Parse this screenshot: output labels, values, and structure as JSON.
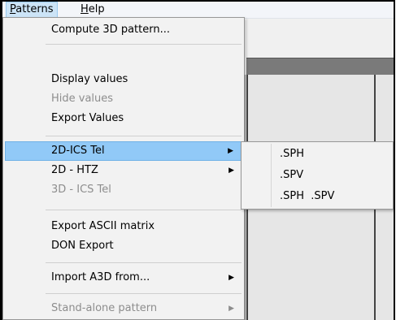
{
  "menubar": {
    "patterns_label": "Patterns",
    "patterns_underline": "P",
    "patterns_rest": "atterns",
    "help_underline": "H",
    "help_rest": "elp"
  },
  "menu": {
    "items": [
      {
        "label": "Compute 3D pattern...",
        "enabled": true
      },
      {
        "label": "Display values",
        "enabled": true
      },
      {
        "label": "Hide values",
        "enabled": false
      },
      {
        "label": "Export Values",
        "enabled": true
      },
      {
        "label": "2D-ICS Tel",
        "enabled": true,
        "submenu": true,
        "highlighted": true
      },
      {
        "label": "2D - HTZ",
        "enabled": true,
        "submenu": true
      },
      {
        "label": "3D - ICS Tel",
        "enabled": false
      },
      {
        "label": "Export ASCII matrix",
        "enabled": true
      },
      {
        "label": "DON Export",
        "enabled": true
      },
      {
        "label": "Import A3D from...",
        "enabled": true,
        "submenu": true
      },
      {
        "label": "Stand-alone pattern",
        "enabled": false,
        "submenu": true
      }
    ],
    "arrow_glyph": "▶"
  },
  "submenu": {
    "items": [
      {
        "label": ".SPH"
      },
      {
        "label": ".SPV"
      },
      {
        "label": ".SPH  .SPV"
      }
    ]
  },
  "colors": {
    "highlight": "#91c9f7",
    "menu_bg": "#f2f2f2",
    "disabled_text": "#8d8d8d"
  }
}
